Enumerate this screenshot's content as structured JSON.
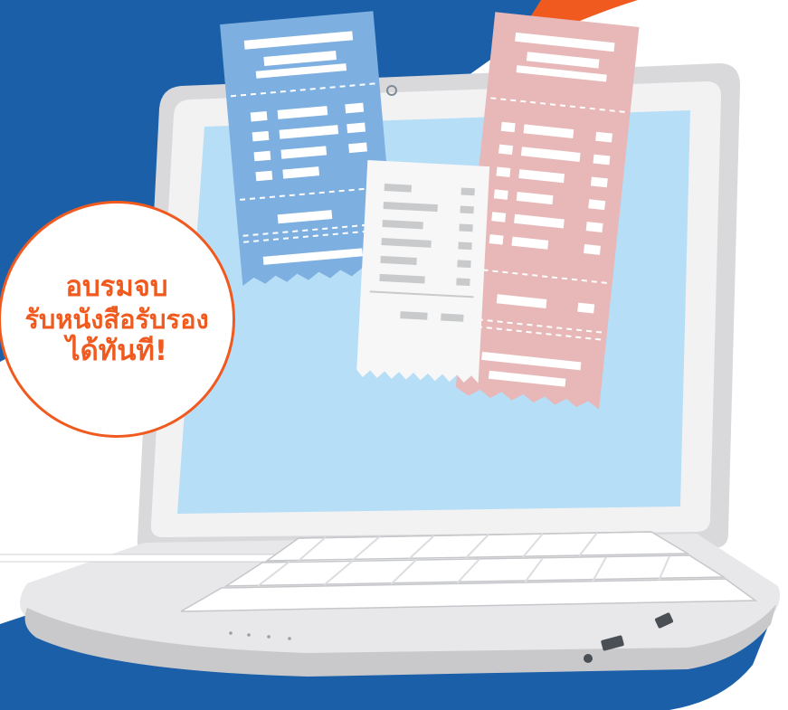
{
  "badge": {
    "line1": "อบรมจบ",
    "line2": "รับหนังสือรับรอง",
    "line3": "ได้ทันที!"
  },
  "colors": {
    "blue_background": "#1a5fa8",
    "accent_orange": "#f05a1f",
    "screen": "#b7def7",
    "receipt_blue": "#7dafe0",
    "receipt_pink": "#e8b7b7",
    "receipt_white": "#f7f7f7"
  },
  "icons": [
    "laptop-illustration",
    "receipt-blue",
    "receipt-white",
    "receipt-pink"
  ]
}
